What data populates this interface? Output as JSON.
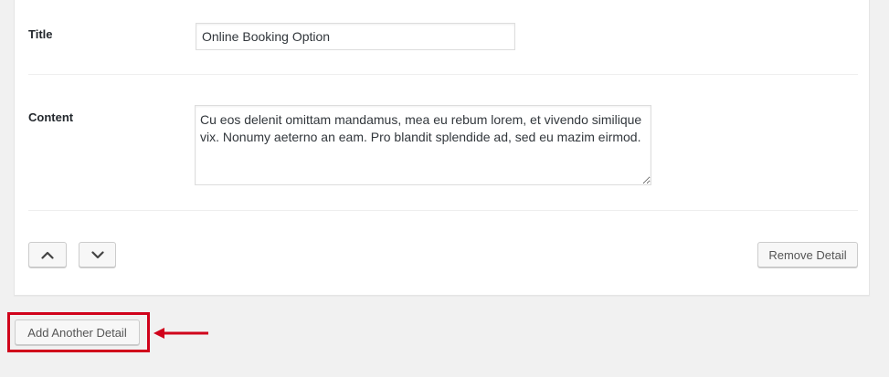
{
  "form": {
    "title_label": "Title",
    "title_value": "Online Booking Option",
    "content_label": "Content",
    "content_value": "Cu eos delenit omittam mandamus, mea eu rebum lorem, et vivendo similique vix. Nonumy aeterno an eam. Pro blandit splendide ad, sed eu mazim eirmod."
  },
  "controls": {
    "move_up_icon": "chevron-up-icon",
    "move_down_icon": "chevron-down-icon",
    "remove_label": "Remove Detail",
    "add_label": "Add Another Detail"
  },
  "annotation": {
    "highlight_color": "#d0021b",
    "arrow_icon": "left-arrow-icon"
  }
}
